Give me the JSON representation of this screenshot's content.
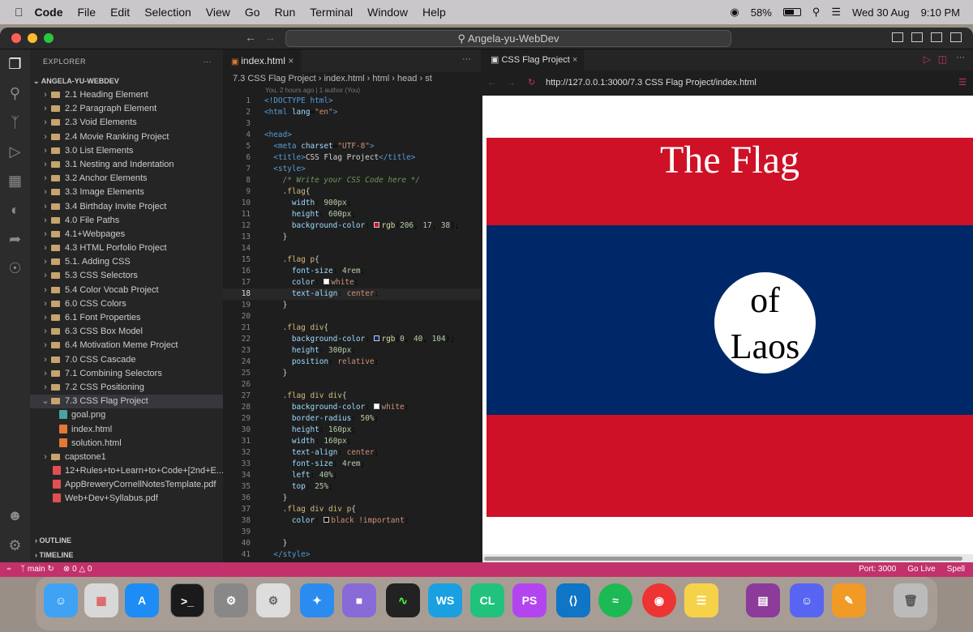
{
  "menubar": {
    "app": "Code",
    "items": [
      "File",
      "Edit",
      "Selection",
      "View",
      "Go",
      "Run",
      "Terminal",
      "Window",
      "Help"
    ],
    "battery": "58%",
    "date": "Wed 30 Aug",
    "time": "9:10 PM"
  },
  "window": {
    "search": "Angela-yu-WebDev"
  },
  "sidebar": {
    "title": "EXPLORER",
    "root": "ANGELA-YU-WEBDEV",
    "items": [
      "2.1 Heading Element",
      "2.2 Paragraph Element",
      "2.3 Void Elements",
      "2.4 Movie Ranking Project",
      "3.0 List Elements",
      "3.1 Nesting and Indentation",
      "3.2 Anchor Elements",
      "3.3 Image Elements",
      "3.4 Birthday Invite Project",
      "4.0 File Paths",
      "4.1+Webpages",
      "4.3 HTML Porfolio Project",
      "5.1. Adding CSS",
      "5.3 CSS Selectors",
      "5.4 Color Vocab Project",
      "6.0 CSS Colors",
      "6.1 Font Properties",
      "6.3 CSS Box Model",
      "6.4 Motivation Meme Project",
      "7.0 CSS Cascade",
      "7.1 Combining Selectors",
      "7.2 CSS Positioning",
      "7.3 CSS Flag Project"
    ],
    "files": [
      "goal.png",
      "index.html",
      "solution.html"
    ],
    "after": [
      "capstone1"
    ],
    "pdfs": [
      "12+Rules+to+Learn+to+Code+[2nd+E...",
      "AppBreweryCornellNotesTemplate.pdf",
      "Web+Dev+Syllabus.pdf"
    ],
    "outline": "OUTLINE",
    "timeline": "TIMELINE"
  },
  "editor": {
    "tab": "index.html",
    "breadcrumb": "7.3 CSS Flag Project  ›  index.html  ›  html  ›  head  ›  st",
    "blame": "You, 2 hours ago | 1 author (You)"
  },
  "code": [
    {
      "n": "1",
      "h": "<span class='t-tag'>&lt;!DOCTYPE html&gt;</span>"
    },
    {
      "n": "2",
      "h": "<span class='t-tag'>&lt;html</span> <span class='t-attr'>lang</span>=<span class='t-str'>\"en\"</span><span class='t-tag'>&gt;</span>"
    },
    {
      "n": "3",
      "h": ""
    },
    {
      "n": "4",
      "h": "<span class='t-tag'>&lt;head&gt;</span>"
    },
    {
      "n": "5",
      "h": "  <span class='t-tag'>&lt;meta</span> <span class='t-attr'>charset</span>=<span class='t-str'>\"UTF-8\"</span><span class='t-tag'>&gt;</span>"
    },
    {
      "n": "6",
      "h": "  <span class='t-tag'>&lt;title&gt;</span><span class='t-txt'>CSS Flag Project</span><span class='t-tag'>&lt;/title&gt;</span>"
    },
    {
      "n": "7",
      "h": "  <span class='t-tag'>&lt;style&gt;</span>"
    },
    {
      "n": "8",
      "h": "    <span class='t-com'>/* Write your CSS Code here */</span>"
    },
    {
      "n": "9",
      "h": "    <span class='t-sel'>.flag</span><span class='t-txt'>{</span>"
    },
    {
      "n": "10",
      "h": "      <span class='t-prop'>width</span>: <span class='t-num'>900px</span>;"
    },
    {
      "n": "11",
      "h": "      <span class='t-prop'>height</span>: <span class='t-num'>600px</span>;"
    },
    {
      "n": "12",
      "h": "      <span class='t-prop'>background-color</span>: <span class='sw' style='background:#ce1126'></span><span class='t-fn'>rgb</span>(<span class='t-num'>206</span>, <span class='t-num'>17</span>, <span class='t-num'>38</span>);"
    },
    {
      "n": "13",
      "h": "    <span class='t-txt'>}</span>"
    },
    {
      "n": "14",
      "h": ""
    },
    {
      "n": "15",
      "h": "    <span class='t-sel'>.flag p</span><span class='t-txt'>{</span>"
    },
    {
      "n": "16",
      "h": "      <span class='t-prop'>font-size</span>: <span class='t-num'>4rem</span>;"
    },
    {
      "n": "17",
      "h": "      <span class='t-prop'>color</span>: <span class='sw' style='background:#fff'></span><span class='t-val'>white</span>;"
    },
    {
      "n": "18",
      "h": "      <span class='t-prop'>text-align</span>: <span class='t-val'>center</span>;"
    },
    {
      "n": "19",
      "h": "    <span class='t-txt'>}</span>"
    },
    {
      "n": "20",
      "h": ""
    },
    {
      "n": "21",
      "h": "    <span class='t-sel'>.flag div</span><span class='t-txt'>{</span>"
    },
    {
      "n": "22",
      "h": "      <span class='t-prop'>background-color</span>: <span class='sw' style='background:#002868'></span><span class='t-fn'>rgb</span>(<span class='t-num'>0</span>, <span class='t-num'>40</span>, <span class='t-num'>104</span>);"
    },
    {
      "n": "23",
      "h": "      <span class='t-prop'>height</span>: <span class='t-num'>300px</span>;"
    },
    {
      "n": "24",
      "h": "      <span class='t-prop'>position</span>: <span class='t-val'>relative</span>;"
    },
    {
      "n": "25",
      "h": "    <span class='t-txt'>}</span>"
    },
    {
      "n": "26",
      "h": ""
    },
    {
      "n": "27",
      "h": "    <span class='t-sel'>.flag div div</span><span class='t-txt'>{</span>"
    },
    {
      "n": "28",
      "h": "      <span class='t-prop'>background-color</span>: <span class='sw' style='background:#fff'></span><span class='t-val'>white</span>;"
    },
    {
      "n": "29",
      "h": "      <span class='t-prop'>border-radius</span>: <span class='t-num'>50%</span>;"
    },
    {
      "n": "30",
      "h": "      <span class='t-prop'>height</span>: <span class='t-num'>160px</span>;"
    },
    {
      "n": "31",
      "h": "      <span class='t-prop'>width</span>: <span class='t-num'>160px</span>;"
    },
    {
      "n": "32",
      "h": "      <span class='t-prop'>text-align</span>: <span class='t-val'>center</span>;"
    },
    {
      "n": "33",
      "h": "      <span class='t-prop'>font-size</span>: <span class='t-num'>4rem</span>;"
    },
    {
      "n": "34",
      "h": "      <span class='t-prop'>left</span>: <span class='t-num'>40%</span>;"
    },
    {
      "n": "35",
      "h": "      <span class='t-prop'>top</span>: <span class='t-num'>25%</span>;"
    },
    {
      "n": "36",
      "h": "    <span class='t-txt'>}</span>"
    },
    {
      "n": "37",
      "h": "    <span class='t-sel'>.flag div div p</span><span class='t-txt'>{</span>"
    },
    {
      "n": "38",
      "h": "      <span class='t-prop'>color</span>: <span class='sw' style='background:#000'></span><span class='t-val'>black !important</span>;"
    },
    {
      "n": "39",
      "h": ""
    },
    {
      "n": "40",
      "h": "    <span class='t-txt'>}</span>"
    },
    {
      "n": "41",
      "h": "  <span class='t-tag'>&lt;/style&gt;</span>"
    }
  ],
  "preview": {
    "tab": "CSS Flag Project",
    "url": "http://127.0.0.1:3000/7.3 CSS Flag Project/index.html",
    "flag_title": "The Flag",
    "circle_line1": "of",
    "circle_line2": "Laos"
  },
  "colors": {
    "flag_red": "#ce1126",
    "flag_blue": "#002868",
    "status": "#c2316c"
  },
  "status": {
    "branch": "main",
    "errors": "0",
    "warnings": "0",
    "port": "Port: 3000",
    "golive": "Go Live",
    "spell": "Spell"
  },
  "dock": {
    "labels": [
      "WS",
      "CL",
      "PS"
    ]
  }
}
